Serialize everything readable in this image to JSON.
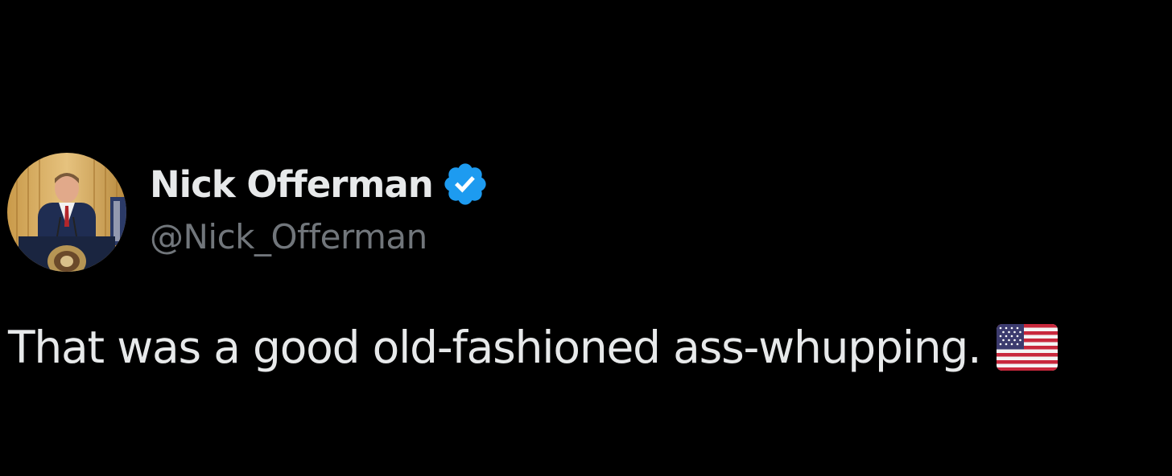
{
  "tweet": {
    "author": {
      "display_name": "Nick Offerman",
      "handle": "@Nick_Offerman",
      "verified": true,
      "avatar_icon": "profile-photo-at-podium"
    },
    "text": "That was a good old-fashioned ass-whupping.",
    "emoji": "us-flag"
  },
  "colors": {
    "background": "#000000",
    "primary_text": "#e7e9ea",
    "secondary_text": "#71767b",
    "verified_blue": "#1d9bf0"
  }
}
